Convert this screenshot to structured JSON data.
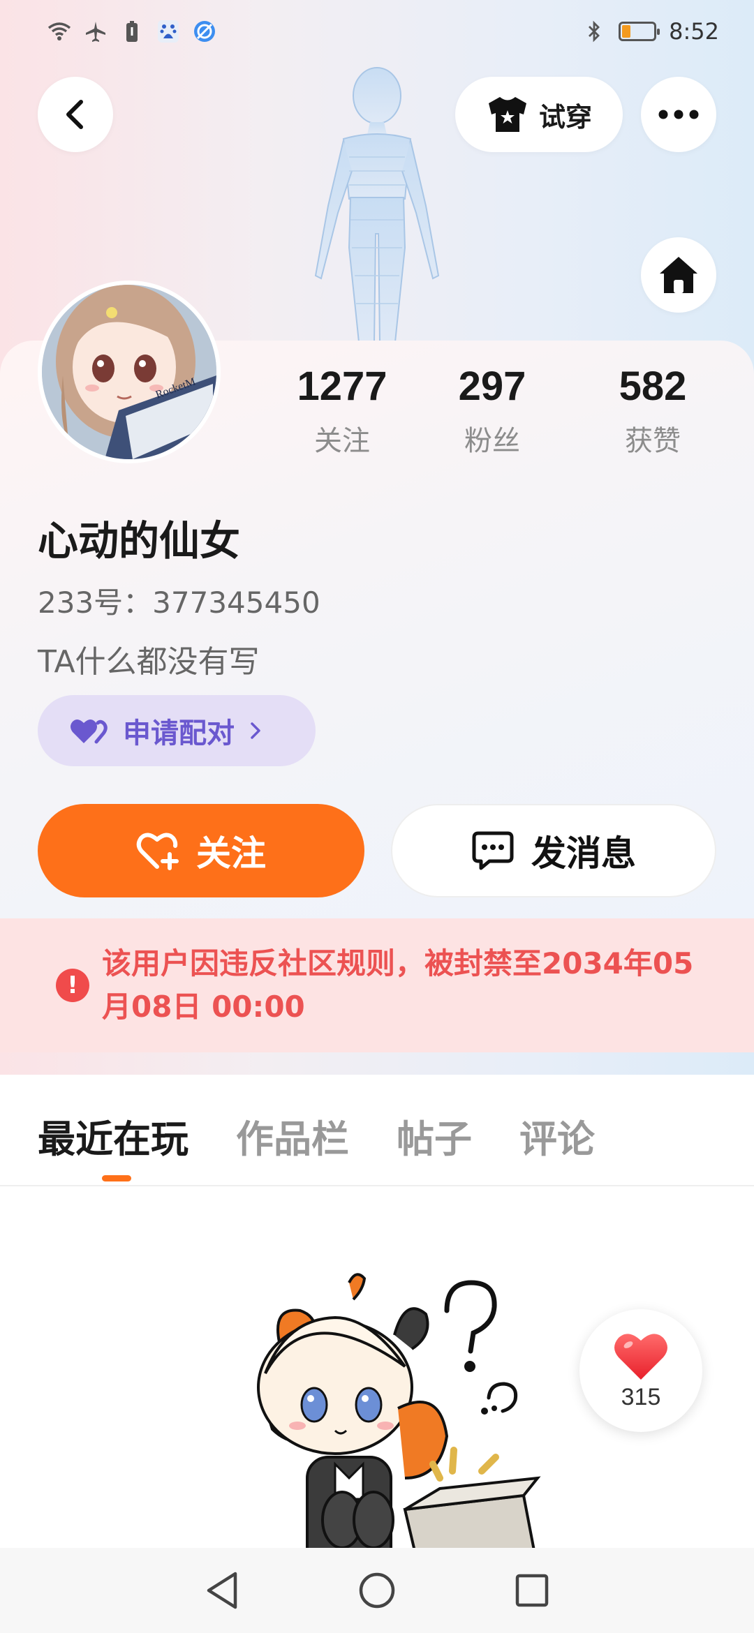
{
  "status_bar": {
    "time": "8:52",
    "left_icons": [
      "wifi-icon",
      "airplane-icon",
      "battery-saver-icon",
      "baidu-icon",
      "browser-icon"
    ],
    "right_icons": [
      "bluetooth-icon",
      "battery-icon"
    ],
    "battery_level": 0.25
  },
  "header": {
    "tryon_label": "试穿"
  },
  "profile": {
    "stats": [
      {
        "value": "1277",
        "label": "关注"
      },
      {
        "value": "297",
        "label": "粉丝"
      },
      {
        "value": "582",
        "label": "获赞"
      }
    ],
    "nickname": "心动的仙女",
    "uid": "233号：377345450",
    "bio": "TA什么都没有写",
    "pair_label": "申请配对",
    "avatar_text": "RocketM"
  },
  "actions": {
    "follow_label": "关注",
    "message_label": "发消息"
  },
  "ban_notice": {
    "text": "该用户因违反社区规则，被封禁至2034年05月08日 00:00"
  },
  "tabs": [
    {
      "label": "最近在玩",
      "active": true
    },
    {
      "label": "作品栏",
      "active": false
    },
    {
      "label": "帖子",
      "active": false
    },
    {
      "label": "评论",
      "active": false
    }
  ],
  "like_float": {
    "count": "315"
  },
  "colors": {
    "accent": "#fe7019",
    "pair_bg": "#e4def6",
    "pair_text": "#6a58cf",
    "ban_bg": "#fde3e3",
    "ban_text": "#ec5252",
    "heart": "#f0373f"
  }
}
